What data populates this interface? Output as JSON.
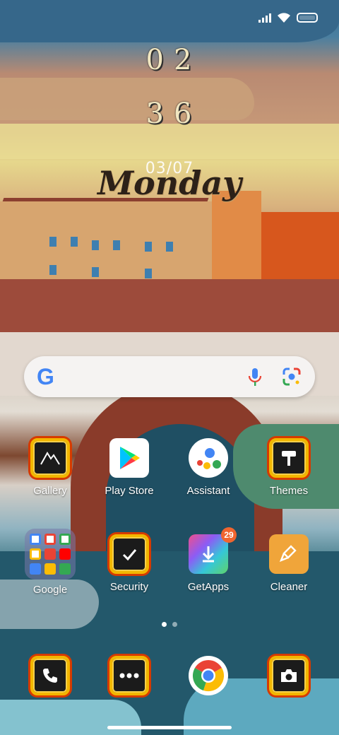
{
  "status_bar": {
    "signal": "signal-icon",
    "wifi": "wifi-icon",
    "battery": "battery-icon"
  },
  "clock": {
    "hours": "02",
    "minutes": "36",
    "date": "03/07",
    "day": "Monday"
  },
  "search": {
    "logo": "G",
    "voice_icon": "mic-icon",
    "lens_icon": "lens-icon"
  },
  "apps_row1": [
    {
      "label": "Gallery"
    },
    {
      "label": "Play Store"
    },
    {
      "label": "Assistant"
    },
    {
      "label": "Themes"
    }
  ],
  "apps_row2": [
    {
      "label": "Google"
    },
    {
      "label": "Security"
    },
    {
      "label": "GetApps",
      "badge": "29"
    },
    {
      "label": "Cleaner"
    }
  ],
  "dock": [
    {
      "icon": "phone-icon"
    },
    {
      "icon": "messages-icon"
    },
    {
      "icon": "chrome-icon"
    },
    {
      "icon": "camera-icon"
    }
  ],
  "colors": {
    "badge": "#f0652f",
    "cleaner": "#f0a53a",
    "fire_frame": "#f2b600"
  }
}
